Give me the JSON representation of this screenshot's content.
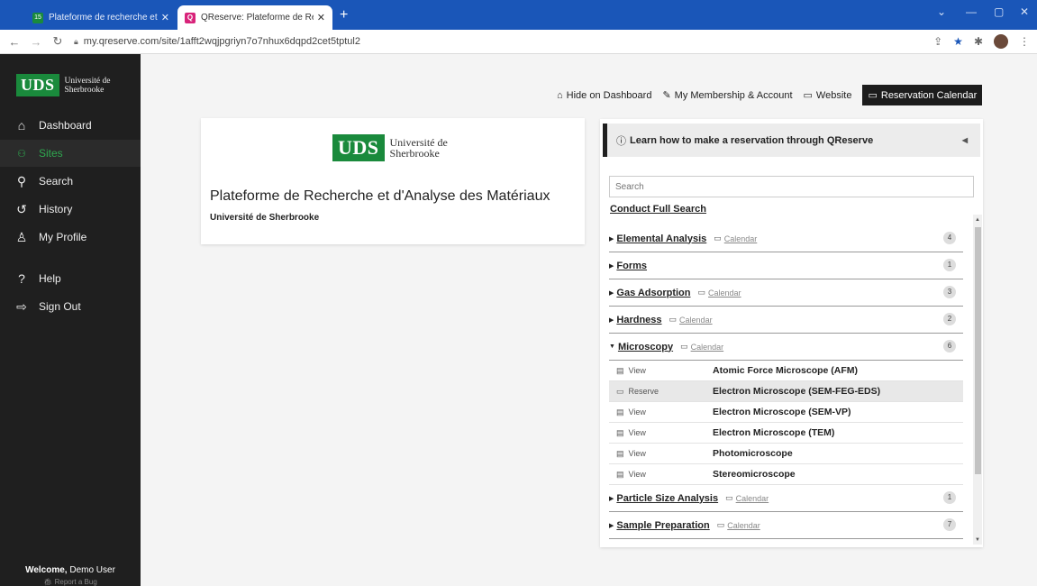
{
  "browser": {
    "tabs": [
      {
        "title": "Plateforme de recherche et d'an",
        "fav_color": "#1a8a3c",
        "fav_text": "15"
      },
      {
        "title": "QReserve: Plateforme de Recher",
        "fav_color": "#d8237a",
        "fav_text": "Q"
      }
    ],
    "url": "my.qreserve.com/site/1afft2wqjpgriyn7o7nhux6dqpd2cet5tptul2",
    "new_tab": "+",
    "close": "✕"
  },
  "sidebar": {
    "logo": {
      "mark": "UDS",
      "name_line1": "Université de",
      "name_line2": "Sherbrooke"
    },
    "items": [
      {
        "label": "Dashboard",
        "icon": "home-icon"
      },
      {
        "label": "Sites",
        "icon": "people-icon"
      },
      {
        "label": "Search",
        "icon": "search-icon"
      },
      {
        "label": "History",
        "icon": "history-icon"
      },
      {
        "label": "My Profile",
        "icon": "user-icon"
      },
      {
        "label": "Help",
        "icon": "help-icon"
      },
      {
        "label": "Sign Out",
        "icon": "signout-icon"
      }
    ],
    "welcome_bold": "Welcome,",
    "welcome_user": " Demo User",
    "report_bug": "Report a Bug"
  },
  "toplinks": {
    "hide": "Hide on Dashboard",
    "membership": "My Membership & Account",
    "website": "Website",
    "calendar": "Reservation Calendar"
  },
  "site_card": {
    "title": "Plateforme de Recherche et d'Analyse des Matériaux",
    "subtitle": "Université de Sherbrooke"
  },
  "panel": {
    "learn": "Learn how to make a reservation through QReserve",
    "search_placeholder": "Search",
    "full_search": "Conduct Full Search",
    "calendar_label": "Calendar",
    "categories": [
      {
        "name": "Elemental Analysis",
        "calendar": true,
        "count": "4"
      },
      {
        "name": "Forms",
        "calendar": false,
        "count": "1"
      },
      {
        "name": "Gas Adsorption",
        "calendar": true,
        "count": "3"
      },
      {
        "name": "Hardness",
        "calendar": true,
        "count": "2"
      },
      {
        "name": "Microscopy",
        "calendar": true,
        "count": "6",
        "expanded": true
      }
    ],
    "microscopy_items": [
      {
        "action": "View",
        "name": "Atomic Force Microscope (AFM)"
      },
      {
        "action": "Reserve",
        "name": "Electron Microscope (SEM-FEG-EDS)",
        "highlight": true
      },
      {
        "action": "View",
        "name": "Electron Microscope (SEM-VP)"
      },
      {
        "action": "View",
        "name": "Electron Microscope (TEM)"
      },
      {
        "action": "View",
        "name": "Photomicroscope"
      },
      {
        "action": "View",
        "name": "Stereomicroscope"
      }
    ],
    "categories_after": [
      {
        "name": "Particle Size Analysis",
        "calendar": true,
        "count": "1"
      },
      {
        "name": "Sample Preparation",
        "calendar": true,
        "count": "7"
      }
    ]
  },
  "colors": {
    "brand_green": "#1a8a3c",
    "browser_blue": "#1a56b8",
    "sidebar_bg": "#1f1f1f"
  }
}
